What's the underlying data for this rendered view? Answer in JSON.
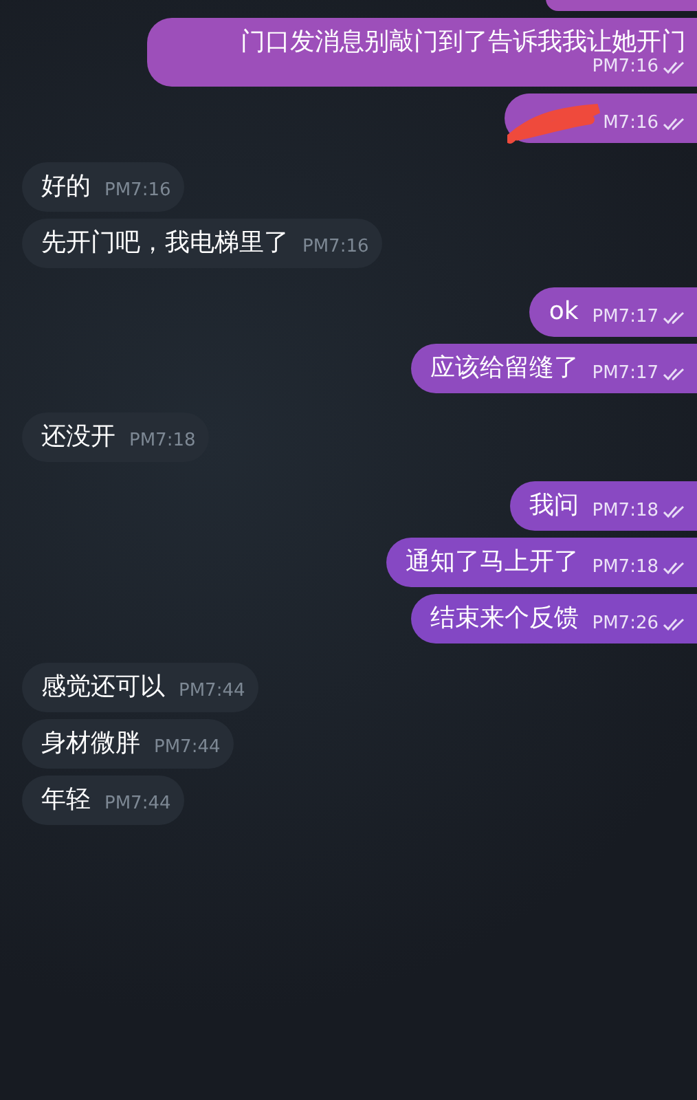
{
  "messages": [
    {
      "kind": "cut"
    },
    {
      "kind": "out",
      "text": "门口发消息别敲门到了告诉我我让她开门",
      "time": "PM7:16"
    },
    {
      "kind": "redacted",
      "time": "M7:16"
    },
    {
      "kind": "in",
      "text": "好的",
      "time": "PM7:16"
    },
    {
      "kind": "in",
      "text": "先开门吧，我电梯里了",
      "time": "PM7:16"
    },
    {
      "kind": "out",
      "text": "ok",
      "time": "PM7:17"
    },
    {
      "kind": "out",
      "text": "应该给留缝了",
      "time": "PM7:17"
    },
    {
      "kind": "in",
      "text": "还没开",
      "time": "PM7:18"
    },
    {
      "kind": "out",
      "text": "我问",
      "time": "PM7:18"
    },
    {
      "kind": "out",
      "text": "通知了马上开了",
      "time": "PM7:18"
    },
    {
      "kind": "out",
      "text": "结束来个反馈",
      "time": "PM7:26"
    },
    {
      "kind": "in",
      "text": "感觉还可以",
      "time": "PM7:44"
    },
    {
      "kind": "in",
      "text": "身材微胖",
      "time": "PM7:44"
    },
    {
      "kind": "in",
      "text": "年轻",
      "time": "PM7:44"
    }
  ]
}
